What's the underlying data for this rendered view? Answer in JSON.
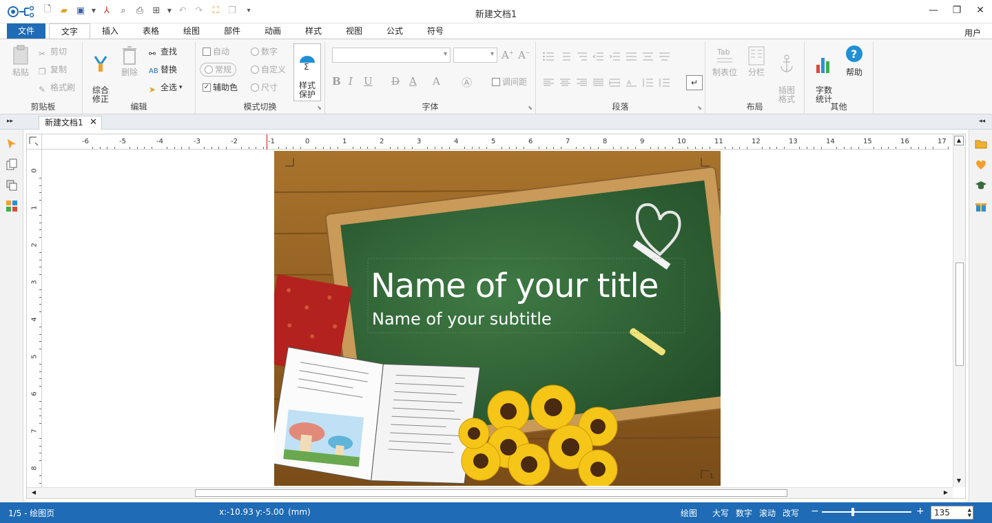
{
  "window": {
    "title": "新建文档1",
    "controls": {
      "minimize": "—",
      "restore": "❐",
      "close": "✕"
    }
  },
  "quick_access": {
    "icons": [
      "new-icon",
      "open-icon",
      "save-icon",
      "pdf-icon",
      "preview-icon",
      "print-icon",
      "format-icon",
      "undo-icon",
      "redo-icon",
      "fit-icon",
      "copy-icon",
      "more-icon"
    ]
  },
  "tabs": [
    {
      "label": "文件",
      "type": "file"
    },
    {
      "label": "文字",
      "active": true
    },
    {
      "label": "插入"
    },
    {
      "label": "表格"
    },
    {
      "label": "绘图"
    },
    {
      "label": "部件"
    },
    {
      "label": "动画"
    },
    {
      "label": "样式"
    },
    {
      "label": "视图"
    },
    {
      "label": "公式"
    },
    {
      "label": "符号"
    }
  ],
  "user_label": "用户",
  "ribbon": {
    "clipboard": {
      "label": "剪贴板",
      "paste": "粘贴",
      "cut": "剪切",
      "copy": "复制",
      "format_painter": "格式刷"
    },
    "edit": {
      "label": "编辑",
      "revise": "综合\n修正",
      "delete": "删除",
      "find": "查找",
      "replace": "替换",
      "select_all": "全选"
    },
    "mode": {
      "label": "模式切换",
      "auto": "自动",
      "normal": "常规",
      "aux_color": "辅助色",
      "number": "数字",
      "custom": "自定义",
      "size": "尺寸",
      "style_protect": "样式\n保护"
    },
    "font": {
      "label": "字体",
      "line_spacing": "调间距"
    },
    "paragraph": {
      "label": "段落"
    },
    "layout": {
      "label": "布局",
      "tab_stop": "制表位",
      "columns": "分栏",
      "image_format": "插图\n格式"
    },
    "other": {
      "label": "其他",
      "word_count": "字数\n统计",
      "help": "帮助"
    }
  },
  "doc_tab": {
    "label": "新建文档1",
    "close": "✕"
  },
  "rulers": {
    "h_ticks": [
      "-6",
      "-5",
      "-4",
      "-3",
      "-2",
      "-1",
      "0",
      "1",
      "2",
      "3",
      "4",
      "5",
      "6",
      "7",
      "8",
      "9",
      "10",
      "11",
      "12",
      "13",
      "14",
      "15",
      "16",
      "17"
    ],
    "v_ticks": [
      "0",
      "1",
      "2",
      "3",
      "4",
      "5",
      "6",
      "7",
      "8"
    ]
  },
  "slide": {
    "title": "Name of your title",
    "subtitle": "Name of your subtitle",
    "page_number": "1"
  },
  "status": {
    "page": "1/5 - 绘图页",
    "x": "x:-10.93",
    "y": "y:-5.00",
    "unit": "(mm)",
    "mode": "绘图",
    "caps": "大写",
    "num": "数字",
    "scroll": "滚动",
    "overwrite": "改写",
    "zoom_minus": "−",
    "zoom_plus": "+",
    "zoom": "135"
  },
  "colors": {
    "accent": "#1f6bb5",
    "board": "#2f6b36",
    "frame": "#c89a55"
  }
}
